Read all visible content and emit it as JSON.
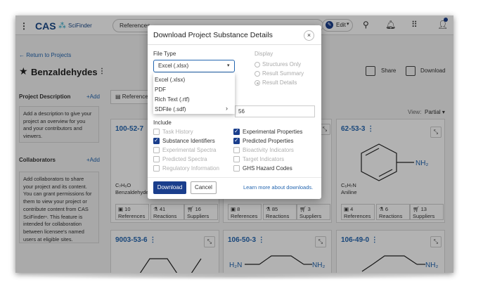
{
  "header": {
    "logo": "CAS",
    "logo_sub": "SciFinder",
    "nav_label": "References",
    "edit_label": "Edit",
    "icons": [
      "menu-icon",
      "search-icon",
      "bell-icon",
      "apps-icon",
      "user-icon"
    ]
  },
  "page": {
    "back_label": "Return to Projects",
    "title": "Benzaldehydes",
    "share_label": "Share",
    "download_label": "Download"
  },
  "sidebar": {
    "description_head": "Project Description",
    "add_label": "+Add",
    "description_text": "Add a description to give your project an overview for you and your contributors and viewers.",
    "collaborators_head": "Collaborators",
    "collaborators_text": "Add collaborators to share your project and its content. You can grant permissions for them to view your project or contribute content from CAS SciFinderⁿ. This feature is intended for collaboration between licensee's named users at eligible sites."
  },
  "main": {
    "refs_tab": "References (",
    "view_label": "View:",
    "view_value": "Partial"
  },
  "cards": [
    {
      "cas": "100-52-7",
      "formula_html": "C₇H₆O",
      "name": "Benzaldehyde",
      "refs": "10",
      "reactions": "41",
      "suppliers": "16"
    },
    {
      "cas": "",
      "formula_html": "",
      "name": "",
      "refs": "8",
      "reactions": "85",
      "suppliers": "3"
    },
    {
      "cas": "62-53-3",
      "formula_html": "C₆H₇N",
      "name": "Aniline",
      "refs": "4",
      "reactions": "6",
      "suppliers": "13"
    },
    {
      "cas": "9003-53-6",
      "formula_html": "",
      "name": "",
      "refs": "",
      "reactions": "",
      "suppliers": ""
    },
    {
      "cas": "106-50-3",
      "formula_html": "",
      "name": "",
      "refs": "",
      "reactions": "",
      "suppliers": ""
    },
    {
      "cas": "106-49-0",
      "formula_html": "",
      "name": "",
      "refs": "",
      "reactions": "",
      "suppliers": ""
    }
  ],
  "stat_labels": {
    "refs": "References",
    "reactions": "Reactions",
    "suppliers": "Suppliers"
  },
  "struct_labels": {
    "nh2": "NH₂",
    "h2n": "H₂N"
  },
  "modal": {
    "title": "Download Project Substance Details",
    "close": "×",
    "file_type_label": "File Type",
    "file_type_value": "Excel (.xlsx)",
    "file_type_options": [
      "Excel (.xlsx)",
      "PDF",
      "Rich Text (.rtf)",
      "SDFile (.sdf)"
    ],
    "display_label": "Display",
    "display_options": [
      "Structures Only",
      "Result Summary",
      "Result Details"
    ],
    "filename_value": "56",
    "include_label": "Include",
    "include_left": [
      {
        "label": "Task History",
        "checked": false,
        "disabled": true
      },
      {
        "label": "Substance Identifiers",
        "checked": true,
        "disabled": false
      },
      {
        "label": "Experimental Spectra",
        "checked": false,
        "disabled": true
      },
      {
        "label": "Predicted Spectra",
        "checked": false,
        "disabled": true
      },
      {
        "label": "Regulatory Information",
        "checked": false,
        "disabled": true
      }
    ],
    "include_right": [
      {
        "label": "Experimental Properties",
        "checked": true,
        "disabled": false
      },
      {
        "label": "Predicted Properties",
        "checked": true,
        "disabled": false
      },
      {
        "label": "Bioactivity Indicators",
        "checked": false,
        "disabled": true
      },
      {
        "label": "Target Indicators",
        "checked": false,
        "disabled": true
      },
      {
        "label": "GHS Hazard Codes",
        "checked": false,
        "disabled": false
      }
    ],
    "download_btn": "Download",
    "cancel_btn": "Cancel",
    "learn_more": "Learn more about downloads."
  }
}
